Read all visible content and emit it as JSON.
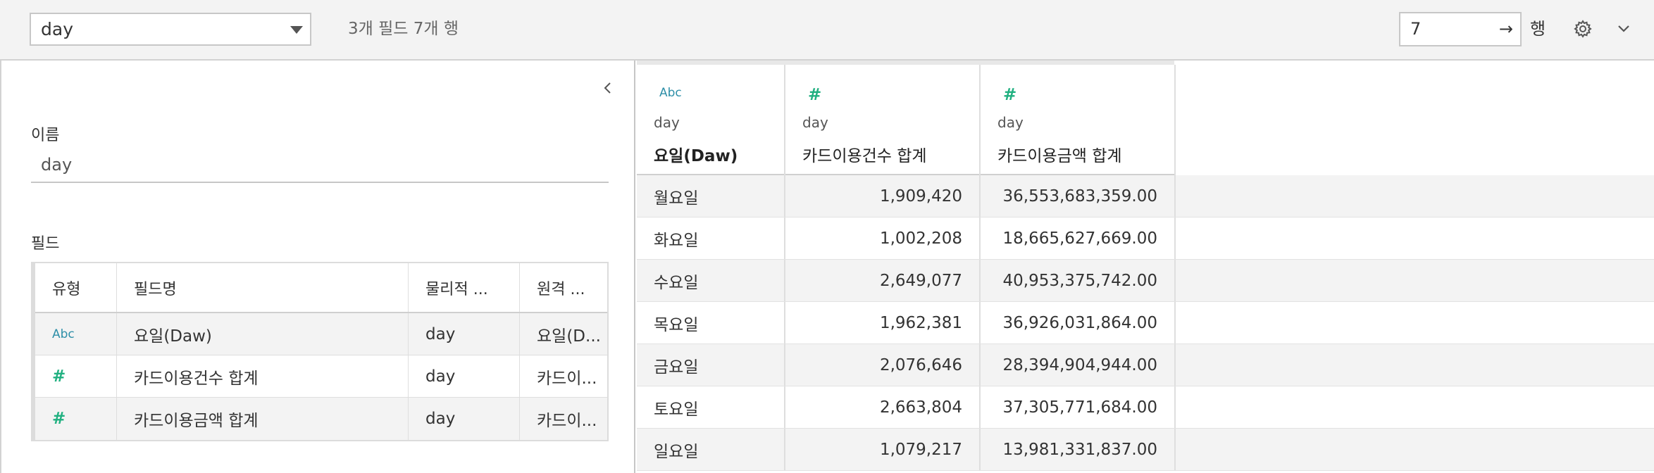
{
  "toolbar": {
    "table_select_value": "day",
    "summary": "3개 필드 7개 행",
    "rows_value": "7",
    "rows_go": "→",
    "rows_label": "행",
    "icons": [
      "chevron-down-icon",
      "arrow-right-icon",
      "gear-icon",
      "chevron-down-icon"
    ]
  },
  "left_panel": {
    "name_label": "이름",
    "name_value": "day",
    "fields_label": "필드",
    "fields_table": {
      "headers": [
        "유형",
        "필드명",
        "물리적 ...",
        "원격 ..."
      ],
      "rows": [
        {
          "type_icon": "abc-icon",
          "type_glyph": "Abc",
          "name": "요일(Daw)",
          "physical": "day",
          "remote": "요일(D..."
        },
        {
          "type_icon": "hash-icon",
          "type_glyph": "#",
          "name": "카드이용건수 합계",
          "physical": "day",
          "remote": "카드이..."
        },
        {
          "type_icon": "hash-icon",
          "type_glyph": "#",
          "name": "카드이용금액 합계",
          "physical": "day",
          "remote": "카드이..."
        }
      ]
    }
  },
  "grid": {
    "columns": [
      {
        "type_icon": "abc-icon",
        "type_glyph": "Abc",
        "source": "day",
        "name": "요일(Daw)"
      },
      {
        "type_icon": "hash-icon",
        "type_glyph": "#",
        "source": "day",
        "name": "카드이용건수 합계"
      },
      {
        "type_icon": "hash-icon",
        "type_glyph": "#",
        "source": "day",
        "name": "카드이용금액 합계"
      }
    ],
    "rows": [
      [
        "월요일",
        "1,909,420",
        "36,553,683,359.00"
      ],
      [
        "화요일",
        "1,002,208",
        "18,665,627,669.00"
      ],
      [
        "수요일",
        "2,649,077",
        "40,953,375,742.00"
      ],
      [
        "목요일",
        "1,962,381",
        "36,926,031,864.00"
      ],
      [
        "금요일",
        "2,076,646",
        "28,394,904,944.00"
      ],
      [
        "토요일",
        "2,663,804",
        "37,305,771,684.00"
      ],
      [
        "일요일",
        "1,079,217",
        "13,981,331,837.00"
      ]
    ]
  },
  "colors": {
    "abc_icon": "#2e8fa8",
    "number_icon": "#20b080",
    "alt_row": "#f3f3f3",
    "toolbar_bg": "#f3f3f3"
  }
}
